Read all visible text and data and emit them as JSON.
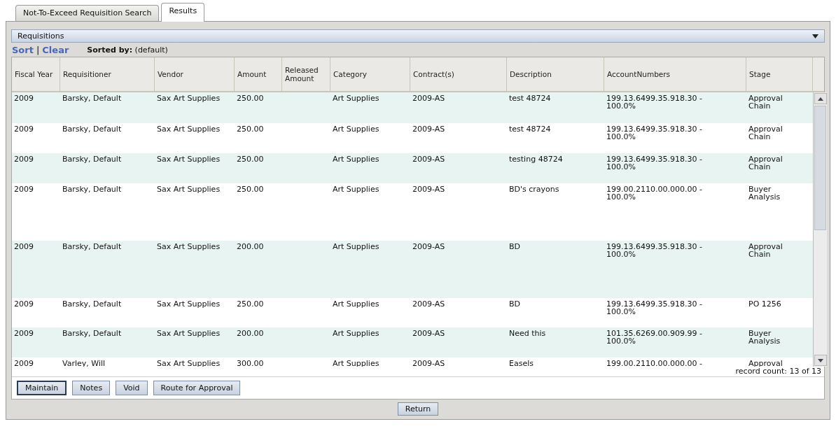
{
  "tabs": [
    {
      "label": "Not-To-Exceed Requisition Search",
      "selected": false
    },
    {
      "label": "Results",
      "selected": true
    }
  ],
  "panel": {
    "title": "Requisitions",
    "sort_link": "Sort",
    "separator": "|",
    "clear_link": "Clear",
    "sorted_by_label": "Sorted by:",
    "sorted_by_value": "(default)"
  },
  "table": {
    "columns": [
      "Fiscal Year",
      "Requisitioner",
      "Vendor",
      "Amount",
      "Released Amount",
      "Category",
      "Contract(s)",
      "Description",
      "AccountNumbers",
      "Stage"
    ],
    "rows": [
      [
        "2009",
        "Barsky, Default",
        "Sax Art Supplies",
        "250.00",
        "",
        "Art Supplies",
        "2009-AS",
        "test 48724",
        "199.13.6499.35.918.30 - 100.0%",
        "Approval Chain"
      ],
      [
        "2009",
        "Barsky, Default",
        "Sax Art Supplies",
        "250.00",
        "",
        "Art Supplies",
        "2009-AS",
        "test 48724",
        "199.13.6499.35.918.30 - 100.0%",
        "Approval Chain"
      ],
      [
        "2009",
        "Barsky, Default",
        "Sax Art Supplies",
        "250.00",
        "",
        "Art Supplies",
        "2009-AS",
        "testing 48724",
        "199.13.6499.35.918.30 - 100.0%",
        "Approval Chain"
      ],
      [
        "2009",
        "Barsky, Default",
        "Sax Art Supplies",
        "250.00",
        "",
        "Art Supplies",
        "2009-AS",
        "BD's crayons",
        "199.00.2110.00.000.00 - 100.0%",
        "Buyer Analysis"
      ],
      [
        "2009",
        "Barsky, Default",
        "Sax Art Supplies",
        "200.00",
        "",
        "Art Supplies",
        "2009-AS",
        "BD",
        "199.13.6499.35.918.30 - 100.0%",
        "Approval Chain"
      ],
      [
        "2009",
        "Barsky, Default",
        "Sax Art Supplies",
        "250.00",
        "",
        "Art Supplies",
        "2009-AS",
        "BD",
        "199.13.6499.35.918.30 - 100.0%",
        "PO 1256"
      ],
      [
        "2009",
        "Barsky, Default",
        "Sax Art Supplies",
        "200.00",
        "",
        "Art Supplies",
        "2009-AS",
        "Need this",
        "101.35.6269.00.909.99 - 100.0%",
        "Buyer Analysis"
      ],
      [
        "2009",
        "Varley, Will",
        "Sax Art Supplies",
        "300.00",
        "",
        "Art Supplies",
        "2009-AS",
        "Easels",
        "199.00.2110.00.000.00 -",
        "Approval"
      ]
    ],
    "record_count": "record count: 13 of 13"
  },
  "buttons": [
    {
      "label": "Maintain",
      "focused": true
    },
    {
      "label": "Notes",
      "focused": false
    },
    {
      "label": "Void",
      "focused": false
    },
    {
      "label": "Route for Approval",
      "focused": false
    }
  ],
  "return_button": {
    "label": "Return"
  }
}
